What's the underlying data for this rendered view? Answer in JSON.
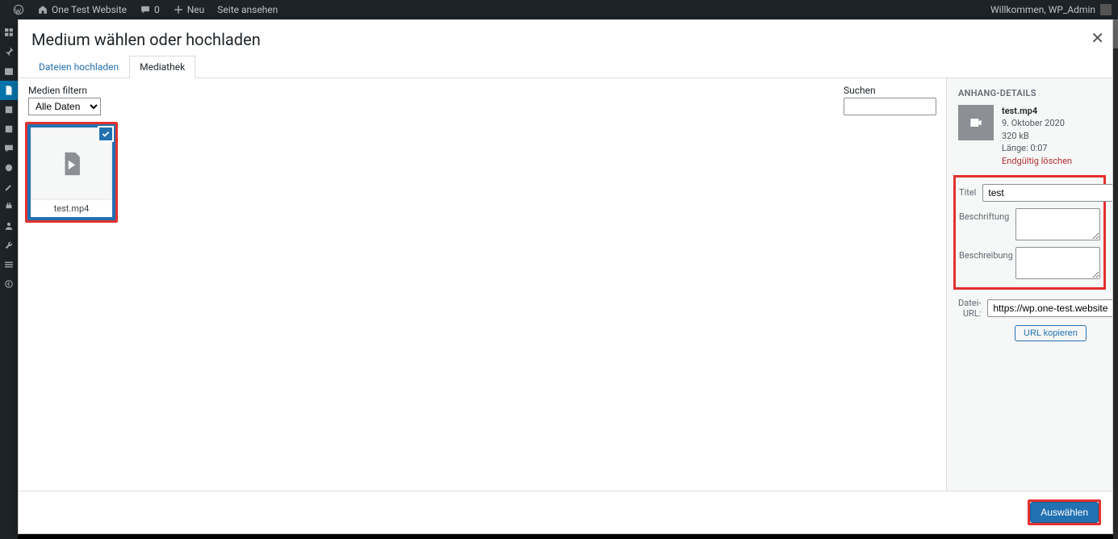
{
  "adminbar": {
    "site_name": "One Test Website",
    "comments_count": "0",
    "new_label": "Neu",
    "view_page": "Seite ansehen",
    "greeting": "Willkommen, WP_Admin"
  },
  "modal": {
    "title": "Medium wählen oder hochladen",
    "tabs": {
      "upload": "Dateien hochladen",
      "library": "Mediathek"
    },
    "filter_label": "Medien filtern",
    "filter_value": "Alle Daten",
    "search_label": "Suchen",
    "search_value": "",
    "attachment": {
      "filename": "test.mp4"
    }
  },
  "sidebar": {
    "heading": "ANHANG-DETAILS",
    "filename": "test.mp4",
    "date": "9. Oktober 2020",
    "size": "320 kB",
    "length": "Länge: 0:07",
    "delete": "Endgültig löschen",
    "fields": {
      "title_label": "Titel",
      "title_value": "test",
      "caption_label": "Beschriftung",
      "caption_value": "",
      "description_label": "Beschreibung",
      "description_value": "",
      "url_label": "Datei-URL:",
      "url_value": "https://wp.one-test.website",
      "copy_url": "URL kopieren"
    }
  },
  "footer": {
    "select": "Auswählen"
  }
}
